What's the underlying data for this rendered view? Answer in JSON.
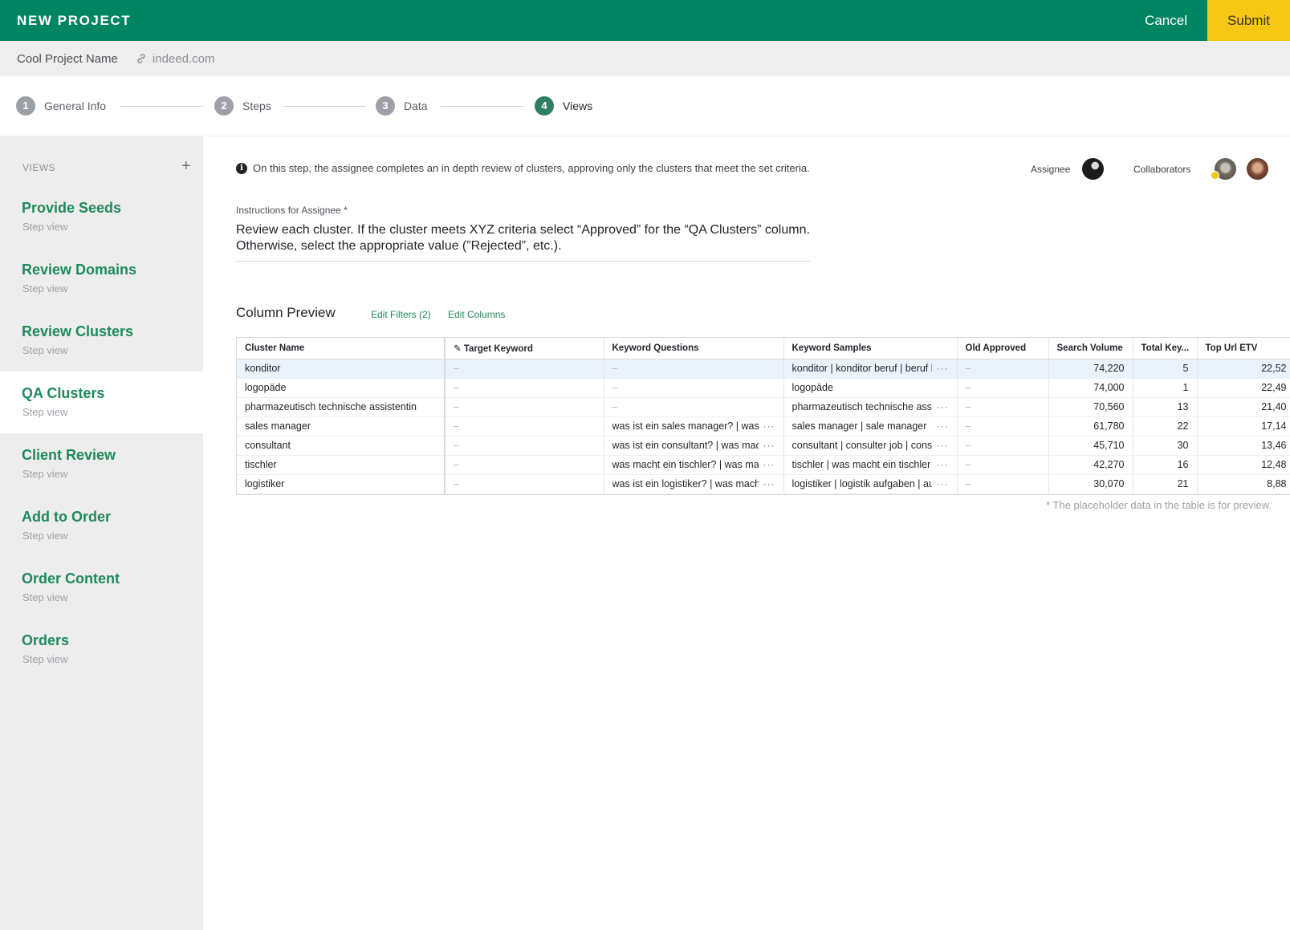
{
  "topbar": {
    "title": "NEW PROJECT",
    "cancel": "Cancel",
    "submit": "Submit"
  },
  "project": {
    "name": "Cool Project Name",
    "link": "indeed.com"
  },
  "steps": [
    {
      "num": "1",
      "label": "General Info"
    },
    {
      "num": "2",
      "label": "Steps"
    },
    {
      "num": "3",
      "label": "Data"
    },
    {
      "num": "4",
      "label": "Views"
    }
  ],
  "sidebar": {
    "header": "VIEWS",
    "add": "+",
    "items": [
      {
        "name": "Provide Seeds",
        "sub": "Step view"
      },
      {
        "name": "Review Domains",
        "sub": "Step view"
      },
      {
        "name": "Review Clusters",
        "sub": "Step view"
      },
      {
        "name": "QA Clusters",
        "sub": "Step view"
      },
      {
        "name": "Client Review",
        "sub": "Step view"
      },
      {
        "name": "Add to Order",
        "sub": "Step view"
      },
      {
        "name": "Order Content",
        "sub": "Step view"
      },
      {
        "name": "Orders",
        "sub": "Step view"
      }
    ]
  },
  "main": {
    "info": "On this step, the assignee completes an in depth review of clusters, approving only the clusters that meet the set criteria.",
    "assignee_label": "Assignee",
    "collaborators_label": "Collaborators",
    "instructions_label": "Instructions for Assignee *",
    "instructions": "Review each cluster. If the cluster meets XYZ criteria select “Approved” for the “QA Clusters” column. Otherwise, select the appropriate value (”Rejected”, etc.).",
    "column_preview": "Column Preview",
    "edit_filters": "Edit Filters (2)",
    "edit_columns": "Edit Columns",
    "footnote": "* The placeholder data in the table is for preview."
  },
  "table": {
    "headers": [
      "Cluster Name",
      "Target Keyword",
      "Keyword Questions",
      "Keyword Samples",
      "Old Approved",
      "Search Volume",
      "Total Key...",
      "Top Url ETV"
    ],
    "rows": [
      [
        "konditor",
        "–",
        "–",
        "konditor | konditor beruf | beruf konditor",
        "–",
        "74,220",
        "5",
        "22,52"
      ],
      [
        "logopäde",
        "–",
        "–",
        "logopäde",
        "–",
        "74,000",
        "1",
        "22,49"
      ],
      [
        "pharmazeutisch technische assistentin",
        "–",
        "–",
        "pharmazeutisch technische assistentin",
        "–",
        "70,560",
        "13",
        "21,40"
      ],
      [
        "sales manager",
        "–",
        "was ist ein sales manager? | was macht",
        "sales manager | sale manager",
        "–",
        "61,780",
        "22",
        "17,14"
      ],
      [
        "consultant",
        "–",
        "was ist ein consultant? | was macht ein",
        "consultant | consulter job | consultant",
        "–",
        "45,710",
        "30",
        "13,46"
      ],
      [
        "tischler",
        "–",
        "was macht ein tischler? | was macht",
        "tischler | was macht ein tischler",
        "–",
        "42,270",
        "16",
        "12,48"
      ],
      [
        "logistiker",
        "–",
        "was ist ein logistiker? | was macht",
        "logistiker | logistik aufgaben | aufgaben",
        "–",
        "30,070",
        "21",
        "8,88"
      ]
    ],
    "more_glyph": "···"
  },
  "colors": {
    "brand_green": "#008563",
    "accent_yellow": "#f7c716",
    "link_green": "#1e8a5c"
  }
}
